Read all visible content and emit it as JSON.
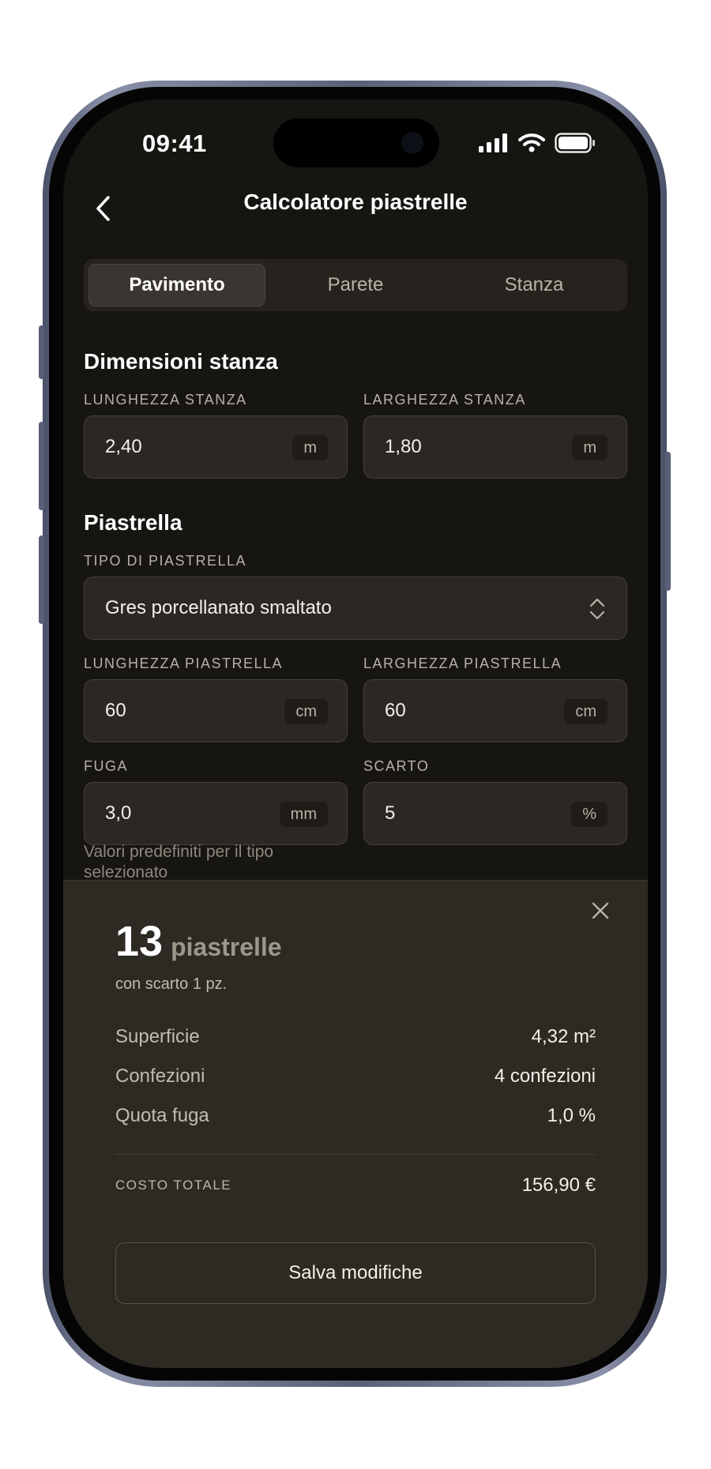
{
  "status": {
    "time": "09:41"
  },
  "nav": {
    "title": "Calcolatore piastrelle",
    "back_icon": "chevron-left-icon"
  },
  "tabs": [
    {
      "label": "Pavimento",
      "active": true
    },
    {
      "label": "Parete",
      "active": false
    },
    {
      "label": "Stanza",
      "active": false
    }
  ],
  "room": {
    "section_title": "Dimensioni stanza",
    "length": {
      "label": "LUNGHEZZA STANZA",
      "value": "2,40",
      "unit": "m"
    },
    "width": {
      "label": "LARGHEZZA STANZA",
      "value": "1,80",
      "unit": "m"
    }
  },
  "tile": {
    "section_title": "Piastrella",
    "type": {
      "label": "TIPO DI PIASTRELLA",
      "value": "Gres porcellanato smaltato"
    },
    "length": {
      "label": "LUNGHEZZA PIASTRELLA",
      "value": "60",
      "unit": "cm"
    },
    "width": {
      "label": "LARGHEZZA PIASTRELLA",
      "value": "60",
      "unit": "cm"
    },
    "joint": {
      "label": "FUGA",
      "value": "3,0",
      "unit": "mm"
    },
    "waste": {
      "label": "SCARTO",
      "value": "5",
      "unit": "%"
    },
    "hint": "Valori predefiniti per il tipo selezionato"
  },
  "result": {
    "count": "13",
    "unit": "piastrelle",
    "subtitle": "con scarto 1 pz.",
    "rows": [
      {
        "label": "Superficie",
        "value": "4,32 m²"
      },
      {
        "label": "Confezioni",
        "value": "4 confezioni"
      },
      {
        "label": "Quota fuga",
        "value": "1,0 %"
      }
    ],
    "total": {
      "label": "COSTO TOTALE",
      "value": "156,90 €"
    },
    "save_label": "Salva modifiche"
  },
  "colors": {
    "background": "#171512",
    "sheet": "#2d2923",
    "field": "#2b2722"
  }
}
